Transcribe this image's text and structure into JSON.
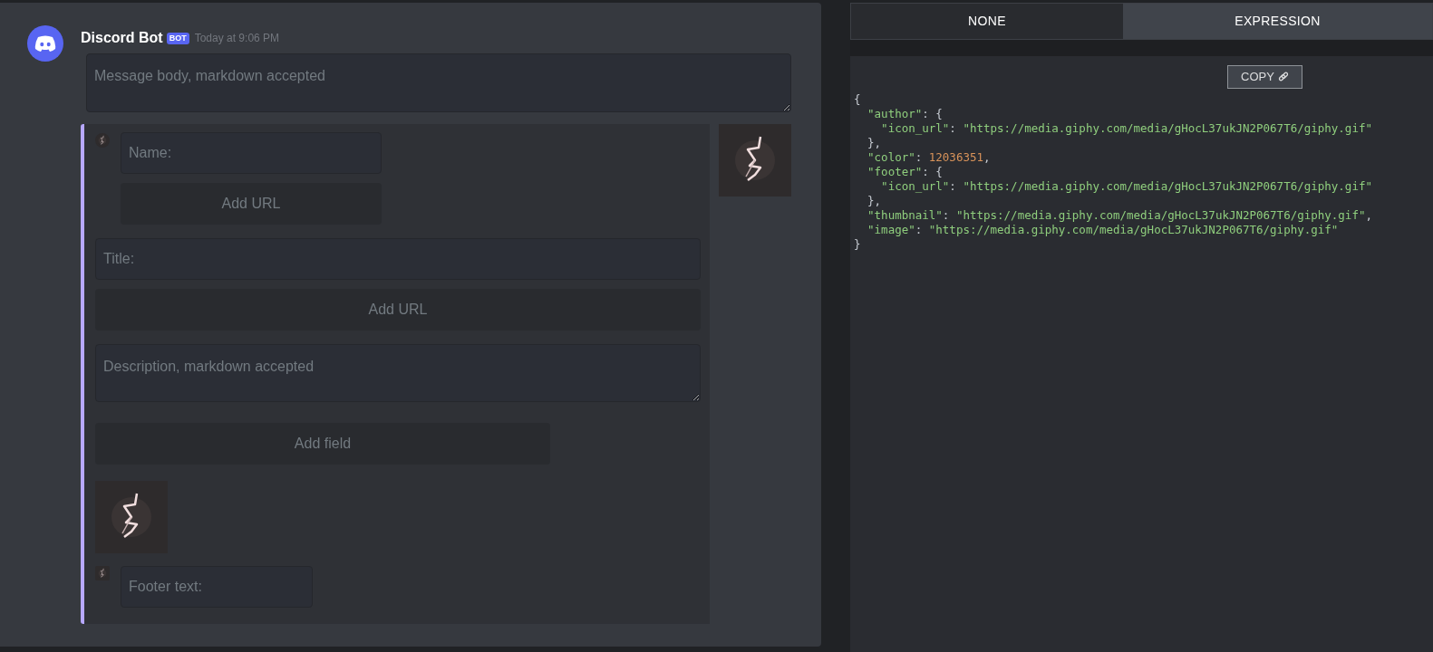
{
  "message": {
    "author": "Discord Bot",
    "badge": "BOT",
    "time": "Today at 9:06 PM",
    "body_placeholder": "Message body, markdown accepted"
  },
  "embed": {
    "color": "#b7a8ff",
    "author_placeholder": "Name:",
    "author_url_button": "Add URL",
    "title_placeholder": "Title:",
    "title_url_button": "Add URL",
    "description_placeholder": "Description, markdown accepted",
    "add_field_button": "Add field",
    "footer_placeholder": "Footer text:"
  },
  "tabs": [
    {
      "label": "NONE",
      "selected": false
    },
    {
      "label": "EXPRESSION",
      "selected": true
    }
  ],
  "copy_button": "COPY",
  "code_lines": [
    [
      {
        "kind": "punct",
        "text": "{"
      }
    ],
    [
      {
        "kind": "key",
        "text": "  \"author\""
      },
      {
        "kind": "punct",
        "text": ": {"
      }
    ],
    [
      {
        "kind": "key",
        "text": "    \"icon_url\""
      },
      {
        "kind": "punct",
        "text": ": "
      },
      {
        "kind": "str",
        "text": "\"https://media.giphy.com/media/gHocL37ukJN2P067T6/giphy.gif\""
      }
    ],
    [
      {
        "kind": "punct",
        "text": "  },"
      }
    ],
    [
      {
        "kind": "key",
        "text": "  \"color\""
      },
      {
        "kind": "punct",
        "text": ": "
      },
      {
        "kind": "num",
        "text": "12036351"
      },
      {
        "kind": "punct",
        "text": ","
      }
    ],
    [
      {
        "kind": "key",
        "text": "  \"footer\""
      },
      {
        "kind": "punct",
        "text": ": {"
      }
    ],
    [
      {
        "kind": "key",
        "text": "    \"icon_url\""
      },
      {
        "kind": "punct",
        "text": ": "
      },
      {
        "kind": "str",
        "text": "\"https://media.giphy.com/media/gHocL37ukJN2P067T6/giphy.gif\""
      }
    ],
    [
      {
        "kind": "punct",
        "text": "  },"
      }
    ],
    [
      {
        "kind": "key",
        "text": "  \"thumbnail\""
      },
      {
        "kind": "punct",
        "text": ": "
      },
      {
        "kind": "str",
        "text": "\"https://media.giphy.com/media/gHocL37ukJN2P067T6/giphy.gif\""
      },
      {
        "kind": "punct",
        "text": ","
      }
    ],
    [
      {
        "kind": "key",
        "text": "  \"image\""
      },
      {
        "kind": "punct",
        "text": ": "
      },
      {
        "kind": "str",
        "text": "\"https://media.giphy.com/media/gHocL37ukJN2P067T6/giphy.gif\""
      }
    ],
    [
      {
        "kind": "punct",
        "text": "}"
      }
    ]
  ]
}
